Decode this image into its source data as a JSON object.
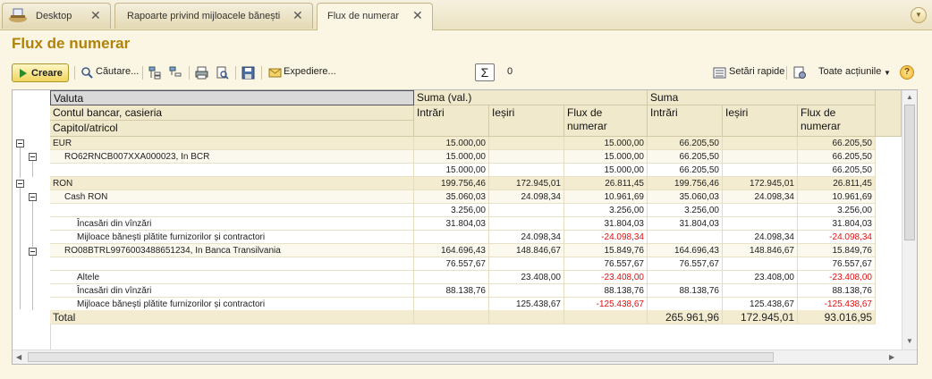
{
  "tabs": [
    {
      "label": "Desktop"
    },
    {
      "label": "Rapoarte privind mijloacele bănești"
    },
    {
      "label": "Flux de numerar"
    }
  ],
  "page_title": "Flux de numerar",
  "toolbar": {
    "create": "Creare",
    "search": "Căutare...",
    "send": "Expediere...",
    "sum_count": "0",
    "quick_settings": "Setări rapide",
    "all_actions": "Toate acțiunile",
    "help": "?"
  },
  "headers": {
    "h1": "Valuta",
    "h2": "Contul bancar, casieria",
    "h3": "Capitol/atricol",
    "suma_val": "Suma (val.)",
    "suma": "Suma",
    "intrari": "Intrări",
    "iesiri": "Ieșiri",
    "flux1": "Flux de",
    "flux2": "numerar"
  },
  "rows": [
    {
      "label": "EUR",
      "v1": "15.000,00",
      "v2": "",
      "v3": "15.000,00",
      "v4": "66.205,50",
      "v5": "",
      "v6": "66.205,50"
    },
    {
      "label": "RO62RNCB007XXA000023, In BCR",
      "v1": "15.000,00",
      "v2": "",
      "v3": "15.000,00",
      "v4": "66.205,50",
      "v5": "",
      "v6": "66.205,50"
    },
    {
      "label": "",
      "v1": "15.000,00",
      "v2": "",
      "v3": "15.000,00",
      "v4": "66.205,50",
      "v5": "",
      "v6": "66.205,50"
    },
    {
      "label": "RON",
      "v1": "199.756,46",
      "v2": "172.945,01",
      "v3": "26.811,45",
      "v4": "199.756,46",
      "v5": "172.945,01",
      "v6": "26.811,45"
    },
    {
      "label": "Cash RON",
      "v1": "35.060,03",
      "v2": "24.098,34",
      "v3": "10.961,69",
      "v4": "35.060,03",
      "v5": "24.098,34",
      "v6": "10.961,69"
    },
    {
      "label": "",
      "v1": "3.256,00",
      "v2": "",
      "v3": "3.256,00",
      "v4": "3.256,00",
      "v5": "",
      "v6": "3.256,00"
    },
    {
      "label": "Încasări din vînzări",
      "v1": "31.804,03",
      "v2": "",
      "v3": "31.804,03",
      "v4": "31.804,03",
      "v5": "",
      "v6": "31.804,03"
    },
    {
      "label": "Mijloace bănești plătite furnizorilor și contractori",
      "v1": "",
      "v2": "24.098,34",
      "v3": "-24.098,34",
      "v4": "",
      "v5": "24.098,34",
      "v6": "-24.098,34"
    },
    {
      "label": "RO08BTRL9976003488651234, In Banca Transilvania",
      "v1": "164.696,43",
      "v2": "148.846,67",
      "v3": "15.849,76",
      "v4": "164.696,43",
      "v5": "148.846,67",
      "v6": "15.849,76"
    },
    {
      "label": "",
      "v1": "76.557,67",
      "v2": "",
      "v3": "76.557,67",
      "v4": "76.557,67",
      "v5": "",
      "v6": "76.557,67"
    },
    {
      "label": "Altele",
      "v1": "",
      "v2": "23.408,00",
      "v3": "-23.408,00",
      "v4": "",
      "v5": "23.408,00",
      "v6": "-23.408,00"
    },
    {
      "label": "Încasări din vînzări",
      "v1": "88.138,76",
      "v2": "",
      "v3": "88.138,76",
      "v4": "88.138,76",
      "v5": "",
      "v6": "88.138,76"
    },
    {
      "label": "Mijloace bănești plătite furnizorilor și contractori",
      "v1": "",
      "v2": "125.438,67",
      "v3": "-125.438,67",
      "v4": "",
      "v5": "125.438,67",
      "v6": "-125.438,67"
    }
  ],
  "total": {
    "label": "Total",
    "v4": "265.961,96",
    "v5": "172.945,01",
    "v6": "93.016,95"
  },
  "colors": {
    "accent": "#b1820a",
    "negative": "#e01010",
    "header_bg": "#f0e9cc"
  }
}
